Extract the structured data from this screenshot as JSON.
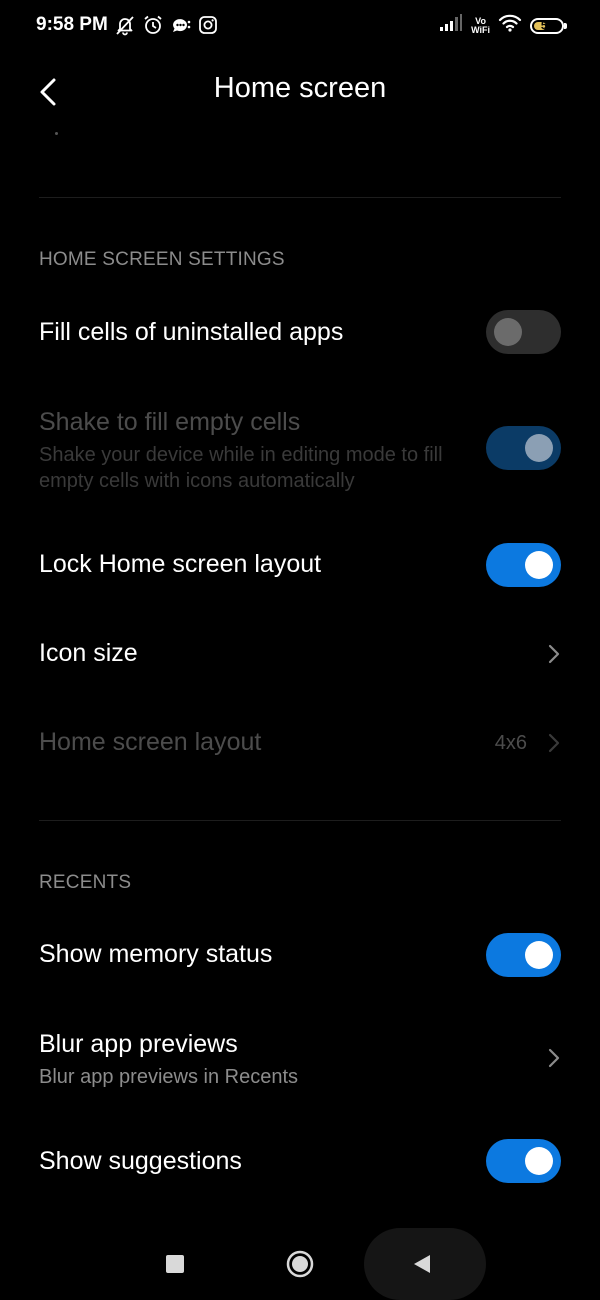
{
  "status_bar": {
    "time": "9:58 PM",
    "left_icons": [
      "mute-notification-icon",
      "alarm-icon",
      "chat-bubble-icon",
      "instagram-icon"
    ],
    "right_icons": [
      "signal-icon",
      "vowifi-icon",
      "wifi-icon",
      "battery-icon"
    ],
    "vowifi_top": "Vo",
    "vowifi_bottom": "WiFi",
    "battery_percent": "52",
    "battery_level": 0.52
  },
  "header": {
    "title": "Home screen",
    "back_icon": "back-chevron-icon"
  },
  "sections": {
    "home": {
      "title": "HOME SCREEN SETTINGS",
      "items": [
        {
          "title": "Fill cells of uninstalled apps",
          "control": "toggle",
          "state": "off",
          "enabled": true
        },
        {
          "title": "Shake to fill empty cells",
          "subtitle": "Shake your device while in editing mode to fill empty cells with icons automatically",
          "control": "toggle",
          "state": "on",
          "enabled": false
        },
        {
          "title": "Lock Home screen layout",
          "control": "toggle",
          "state": "on",
          "enabled": true
        },
        {
          "title": "Icon size",
          "control": "chevron",
          "enabled": true
        },
        {
          "title": "Home screen layout",
          "value": "4x6",
          "control": "chevron",
          "enabled": false
        }
      ]
    },
    "recents": {
      "title": "RECENTS",
      "items": [
        {
          "title": "Show memory status",
          "control": "toggle",
          "state": "on",
          "enabled": true
        },
        {
          "title": "Blur app previews",
          "subtitle": "Blur app previews in Recents",
          "control": "chevron",
          "enabled": true
        },
        {
          "title": "Show suggestions",
          "control": "toggle",
          "state": "on",
          "enabled": true
        }
      ]
    }
  },
  "nav_bar": {
    "icons": [
      "recents-square-icon",
      "home-circle-icon",
      "back-triangle-icon"
    ]
  },
  "colors": {
    "background": "#000000",
    "accent": "#0c79e0",
    "secondary_text": "#8c8c8c",
    "disabled_text": "#4c4c4c"
  }
}
